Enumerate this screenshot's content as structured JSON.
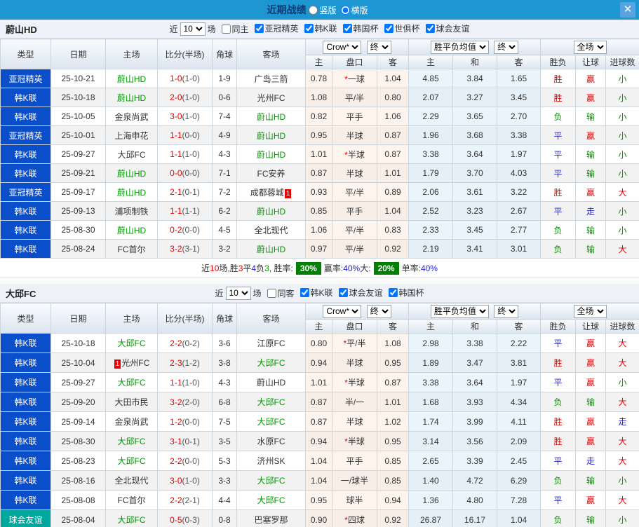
{
  "titlebar": {
    "title": "近期战绩",
    "radios": [
      {
        "label": "竖版",
        "checked": false
      },
      {
        "label": "横版",
        "checked": true
      }
    ],
    "close": "✕"
  },
  "table_header": {
    "type": "类型",
    "date": "日期",
    "home": "主场",
    "score": "比分(半场)",
    "corner": "角球",
    "away": "客场",
    "odds_select": "Crow*",
    "final_select": "终",
    "avg_select": "胜平负均值",
    "final_select2": "终",
    "scope_select": "全场",
    "odds_home": "主",
    "odds_handicap": "盘口",
    "odds_away": "客",
    "avg_home": "主",
    "avg_draw": "和",
    "avg_away": "客",
    "result": "胜负",
    "handicap_result": "让球",
    "goals": "进球数"
  },
  "sections": [
    {
      "team": "蔚山HD",
      "filters": {
        "prefix": "近",
        "count": "10",
        "suffix": "场",
        "same": {
          "label": "同主",
          "checked": false
        },
        "comps": [
          {
            "label": "亚冠精英",
            "checked": true
          },
          {
            "label": "韩K联",
            "checked": true
          },
          {
            "label": "韩国杯",
            "checked": true
          },
          {
            "label": "世俱杯",
            "checked": true
          },
          {
            "label": "球会友谊",
            "checked": true
          }
        ]
      },
      "rows": [
        {
          "type": "亚冠精英",
          "tc": "blue",
          "date": "25-10-21",
          "home": {
            "name": "蔚山HD",
            "self": true
          },
          "score": "1-0",
          "half": "(1-0)",
          "corner": "1-9",
          "away": {
            "name": "广岛三箭",
            "self": false
          },
          "o1": "0.78",
          "hc": "*一球",
          "o2": "1.04",
          "a1": "4.85",
          "a2": "3.84",
          "a3": "1.65",
          "r1": {
            "t": "胜",
            "c": "r"
          },
          "r2": {
            "t": "赢",
            "c": "r"
          },
          "r3": {
            "t": "小",
            "c": "g"
          }
        },
        {
          "type": "韩K联",
          "tc": "blue",
          "date": "25-10-18",
          "home": {
            "name": "蔚山HD",
            "self": true
          },
          "score": "2-0",
          "half": "(1-0)",
          "corner": "0-6",
          "away": {
            "name": "光州FC",
            "self": false
          },
          "o1": "1.08",
          "hc": "平/半",
          "o2": "0.80",
          "a1": "2.07",
          "a2": "3.27",
          "a3": "3.45",
          "r1": {
            "t": "胜",
            "c": "r"
          },
          "r2": {
            "t": "赢",
            "c": "r"
          },
          "r3": {
            "t": "小",
            "c": "g"
          }
        },
        {
          "type": "韩K联",
          "tc": "blue",
          "date": "25-10-05",
          "home": {
            "name": "金泉尚武",
            "self": false
          },
          "score": "3-0",
          "half": "(1-0)",
          "corner": "7-4",
          "away": {
            "name": "蔚山HD",
            "self": true
          },
          "o1": "0.82",
          "hc": "平手",
          "o2": "1.06",
          "a1": "2.29",
          "a2": "3.65",
          "a3": "2.70",
          "r1": {
            "t": "负",
            "c": "g"
          },
          "r2": {
            "t": "输",
            "c": "g"
          },
          "r3": {
            "t": "小",
            "c": "g"
          }
        },
        {
          "type": "亚冠精英",
          "tc": "blue",
          "date": "25-10-01",
          "home": {
            "name": "上海申花",
            "self": false
          },
          "score": "1-1",
          "half": "(0-0)",
          "corner": "4-9",
          "away": {
            "name": "蔚山HD",
            "self": true
          },
          "o1": "0.95",
          "hc": "半球",
          "o2": "0.87",
          "a1": "1.96",
          "a2": "3.68",
          "a3": "3.38",
          "r1": {
            "t": "平",
            "c": "b"
          },
          "r2": {
            "t": "赢",
            "c": "r"
          },
          "r3": {
            "t": "小",
            "c": "g"
          }
        },
        {
          "type": "韩K联",
          "tc": "blue",
          "date": "25-09-27",
          "home": {
            "name": "大邱FC",
            "self": false
          },
          "score": "1-1",
          "half": "(1-0)",
          "corner": "4-3",
          "away": {
            "name": "蔚山HD",
            "self": true
          },
          "o1": "1.01",
          "hc": "*半球",
          "o2": "0.87",
          "a1": "3.38",
          "a2": "3.64",
          "a3": "1.97",
          "r1": {
            "t": "平",
            "c": "b"
          },
          "r2": {
            "t": "输",
            "c": "g"
          },
          "r3": {
            "t": "小",
            "c": "g"
          }
        },
        {
          "type": "韩K联",
          "tc": "blue",
          "date": "25-09-21",
          "home": {
            "name": "蔚山HD",
            "self": true
          },
          "score": "0-0",
          "half": "(0-0)",
          "corner": "7-1",
          "away": {
            "name": "FC安养",
            "self": false
          },
          "o1": "0.87",
          "hc": "半球",
          "o2": "1.01",
          "a1": "1.79",
          "a2": "3.70",
          "a3": "4.03",
          "r1": {
            "t": "平",
            "c": "b"
          },
          "r2": {
            "t": "输",
            "c": "g"
          },
          "r3": {
            "t": "小",
            "c": "g"
          }
        },
        {
          "type": "亚冠精英",
          "tc": "blue",
          "date": "25-09-17",
          "home": {
            "name": "蔚山HD",
            "self": true
          },
          "score": "2-1",
          "half": "(0-1)",
          "corner": "7-2",
          "away": {
            "name": "成都蓉城",
            "self": false,
            "card": "1",
            "cardPos": "after"
          },
          "o1": "0.93",
          "hc": "平/半",
          "o2": "0.89",
          "a1": "2.06",
          "a2": "3.61",
          "a3": "3.22",
          "r1": {
            "t": "胜",
            "c": "r"
          },
          "r2": {
            "t": "赢",
            "c": "r"
          },
          "r3": {
            "t": "大",
            "c": "r"
          }
        },
        {
          "type": "韩K联",
          "tc": "blue",
          "date": "25-09-13",
          "home": {
            "name": "浦项制铁",
            "self": false
          },
          "score": "1-1",
          "half": "(1-1)",
          "corner": "6-2",
          "away": {
            "name": "蔚山HD",
            "self": true
          },
          "o1": "0.85",
          "hc": "平手",
          "o2": "1.04",
          "a1": "2.52",
          "a2": "3.23",
          "a3": "2.67",
          "r1": {
            "t": "平",
            "c": "b"
          },
          "r2": {
            "t": "走",
            "c": "b"
          },
          "r3": {
            "t": "小",
            "c": "g"
          }
        },
        {
          "type": "韩K联",
          "tc": "blue",
          "date": "25-08-30",
          "home": {
            "name": "蔚山HD",
            "self": true
          },
          "score": "0-2",
          "half": "(0-0)",
          "corner": "4-5",
          "away": {
            "name": "全北现代",
            "self": false
          },
          "o1": "1.06",
          "hc": "平/半",
          "o2": "0.83",
          "a1": "2.33",
          "a2": "3.45",
          "a3": "2.77",
          "r1": {
            "t": "负",
            "c": "g"
          },
          "r2": {
            "t": "输",
            "c": "g"
          },
          "r3": {
            "t": "小",
            "c": "g"
          }
        },
        {
          "type": "韩K联",
          "tc": "blue",
          "date": "25-08-24",
          "home": {
            "name": "FC首尔",
            "self": false
          },
          "score": "3-2",
          "half": "(3-1)",
          "corner": "3-2",
          "away": {
            "name": "蔚山HD",
            "self": true
          },
          "o1": "0.97",
          "hc": "平/半",
          "o2": "0.92",
          "a1": "2.19",
          "a2": "3.41",
          "a3": "3.01",
          "r1": {
            "t": "负",
            "c": "g"
          },
          "r2": {
            "t": "输",
            "c": "g"
          },
          "r3": {
            "t": "大",
            "c": "r"
          }
        }
      ],
      "summary": {
        "parts": [
          {
            "t": "近",
            "c": "k"
          },
          {
            "t": "10",
            "c": "r"
          },
          {
            "t": "场,胜",
            "c": "k"
          },
          {
            "t": "3",
            "c": "r"
          },
          {
            "t": "平",
            "c": "k"
          },
          {
            "t": "4",
            "c": "b"
          },
          {
            "t": "负",
            "c": "k"
          },
          {
            "t": "3",
            "c": "g"
          },
          {
            "t": ", 胜率: ",
            "c": "k"
          },
          {
            "t": "30%",
            "c": "badge"
          },
          {
            "t": " 赢率:",
            "c": "k"
          },
          {
            "t": "40%",
            "c": "b"
          },
          {
            "t": " 大: ",
            "c": "k"
          },
          {
            "t": "20%",
            "c": "badge"
          },
          {
            "t": " 单率:",
            "c": "k"
          },
          {
            "t": "40%",
            "c": "b"
          }
        ]
      }
    },
    {
      "team": "大邱FC",
      "filters": {
        "prefix": "近",
        "count": "10",
        "suffix": "场",
        "same": {
          "label": "同客",
          "checked": false
        },
        "comps": [
          {
            "label": "韩K联",
            "checked": true
          },
          {
            "label": "球会友谊",
            "checked": true
          },
          {
            "label": "韩国杯",
            "checked": true
          }
        ]
      },
      "rows": [
        {
          "type": "韩K联",
          "tc": "blue",
          "date": "25-10-18",
          "home": {
            "name": "大邱FC",
            "self": true
          },
          "score": "2-2",
          "half": "(0-2)",
          "corner": "3-6",
          "away": {
            "name": "江原FC",
            "self": false
          },
          "o1": "0.80",
          "hc": "*平/半",
          "o2": "1.08",
          "a1": "2.98",
          "a2": "3.38",
          "a3": "2.22",
          "r1": {
            "t": "平",
            "c": "b"
          },
          "r2": {
            "t": "赢",
            "c": "r"
          },
          "r3": {
            "t": "大",
            "c": "r"
          }
        },
        {
          "type": "韩K联",
          "tc": "blue",
          "date": "25-10-04",
          "home": {
            "name": "光州FC",
            "self": false,
            "card": "1",
            "cardPos": "before"
          },
          "score": "2-3",
          "half": "(1-2)",
          "corner": "3-8",
          "away": {
            "name": "大邱FC",
            "self": true
          },
          "o1": "0.94",
          "hc": "半球",
          "o2": "0.95",
          "a1": "1.89",
          "a2": "3.47",
          "a3": "3.81",
          "r1": {
            "t": "胜",
            "c": "r"
          },
          "r2": {
            "t": "赢",
            "c": "r"
          },
          "r3": {
            "t": "大",
            "c": "r"
          }
        },
        {
          "type": "韩K联",
          "tc": "blue",
          "date": "25-09-27",
          "home": {
            "name": "大邱FC",
            "self": true
          },
          "score": "1-1",
          "half": "(1-0)",
          "corner": "4-3",
          "away": {
            "name": "蔚山HD",
            "self": false
          },
          "o1": "1.01",
          "hc": "*半球",
          "o2": "0.87",
          "a1": "3.38",
          "a2": "3.64",
          "a3": "1.97",
          "r1": {
            "t": "平",
            "c": "b"
          },
          "r2": {
            "t": "赢",
            "c": "r"
          },
          "r3": {
            "t": "小",
            "c": "g"
          }
        },
        {
          "type": "韩K联",
          "tc": "blue",
          "date": "25-09-20",
          "home": {
            "name": "大田市民",
            "self": false
          },
          "score": "3-2",
          "half": "(2-0)",
          "corner": "6-8",
          "away": {
            "name": "大邱FC",
            "self": true
          },
          "o1": "0.87",
          "hc": "半/一",
          "o2": "1.01",
          "a1": "1.68",
          "a2": "3.93",
          "a3": "4.34",
          "r1": {
            "t": "负",
            "c": "g"
          },
          "r2": {
            "t": "输",
            "c": "g"
          },
          "r3": {
            "t": "大",
            "c": "r"
          }
        },
        {
          "type": "韩K联",
          "tc": "blue",
          "date": "25-09-14",
          "home": {
            "name": "金泉尚武",
            "self": false
          },
          "score": "1-2",
          "half": "(0-0)",
          "corner": "7-5",
          "away": {
            "name": "大邱FC",
            "self": true
          },
          "o1": "0.87",
          "hc": "半球",
          "o2": "1.02",
          "a1": "1.74",
          "a2": "3.99",
          "a3": "4.11",
          "r1": {
            "t": "胜",
            "c": "r"
          },
          "r2": {
            "t": "赢",
            "c": "r"
          },
          "r3": {
            "t": "走",
            "c": "b"
          }
        },
        {
          "type": "韩K联",
          "tc": "blue",
          "date": "25-08-30",
          "home": {
            "name": "大邱FC",
            "self": true
          },
          "score": "3-1",
          "half": "(0-1)",
          "corner": "3-5",
          "away": {
            "name": "水原FC",
            "self": false
          },
          "o1": "0.94",
          "hc": "*半球",
          "o2": "0.95",
          "a1": "3.14",
          "a2": "3.56",
          "a3": "2.09",
          "r1": {
            "t": "胜",
            "c": "r"
          },
          "r2": {
            "t": "赢",
            "c": "r"
          },
          "r3": {
            "t": "大",
            "c": "r"
          }
        },
        {
          "type": "韩K联",
          "tc": "blue",
          "date": "25-08-23",
          "home": {
            "name": "大邱FC",
            "self": true
          },
          "score": "2-2",
          "half": "(0-0)",
          "corner": "5-3",
          "away": {
            "name": "济州SK",
            "self": false
          },
          "o1": "1.04",
          "hc": "平手",
          "o2": "0.85",
          "a1": "2.65",
          "a2": "3.39",
          "a3": "2.45",
          "r1": {
            "t": "平",
            "c": "b"
          },
          "r2": {
            "t": "走",
            "c": "b"
          },
          "r3": {
            "t": "大",
            "c": "r"
          }
        },
        {
          "type": "韩K联",
          "tc": "blue",
          "date": "25-08-16",
          "home": {
            "name": "全北现代",
            "self": false
          },
          "score": "3-0",
          "half": "(1-0)",
          "corner": "3-3",
          "away": {
            "name": "大邱FC",
            "self": true
          },
          "o1": "1.04",
          "hc": "一/球半",
          "o2": "0.85",
          "a1": "1.40",
          "a2": "4.72",
          "a3": "6.29",
          "r1": {
            "t": "负",
            "c": "g"
          },
          "r2": {
            "t": "输",
            "c": "g"
          },
          "r3": {
            "t": "小",
            "c": "g"
          }
        },
        {
          "type": "韩K联",
          "tc": "blue",
          "date": "25-08-08",
          "home": {
            "name": "FC首尔",
            "self": false
          },
          "score": "2-2",
          "half": "(2-1)",
          "corner": "4-4",
          "away": {
            "name": "大邱FC",
            "self": true
          },
          "o1": "0.95",
          "hc": "球半",
          "o2": "0.94",
          "a1": "1.36",
          "a2": "4.80",
          "a3": "7.28",
          "r1": {
            "t": "平",
            "c": "b"
          },
          "r2": {
            "t": "赢",
            "c": "r"
          },
          "r3": {
            "t": "大",
            "c": "r"
          }
        },
        {
          "type": "球会友谊",
          "tc": "teal",
          "date": "25-08-04",
          "home": {
            "name": "大邱FC",
            "self": true
          },
          "score": "0-5",
          "half": "(0-3)",
          "corner": "0-8",
          "away": {
            "name": "巴塞罗那",
            "self": false
          },
          "o1": "0.90",
          "hc": "*四球",
          "o2": "0.92",
          "a1": "26.87",
          "a2": "16.17",
          "a3": "1.04",
          "r1": {
            "t": "负",
            "c": "g"
          },
          "r2": {
            "t": "输",
            "c": "g"
          },
          "r3": {
            "t": "小",
            "c": "g"
          }
        }
      ],
      "summary": null
    }
  ]
}
